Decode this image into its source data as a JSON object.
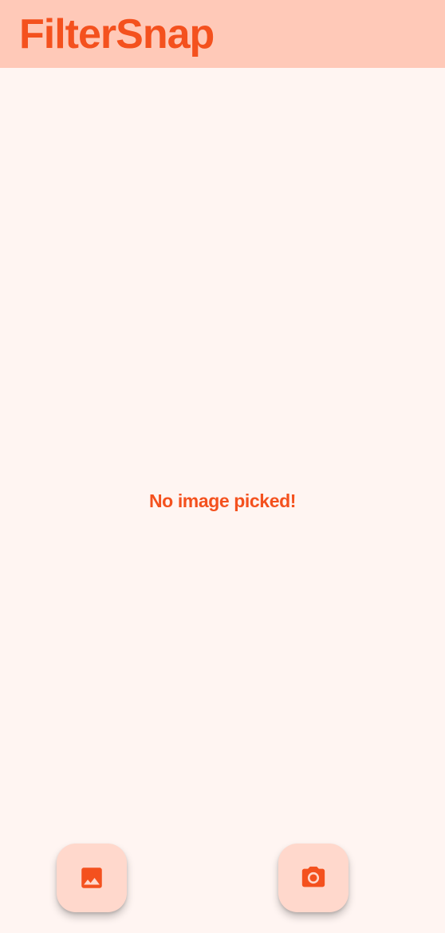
{
  "app": {
    "title": "FilterSnap"
  },
  "main": {
    "empty_message": "No image picked!"
  },
  "actions": {
    "gallery_icon": "image-icon",
    "camera_icon": "camera-icon"
  },
  "colors": {
    "accent": "#F4511E",
    "appbar_background": "#FFC9B8",
    "page_background": "#FFF5F2",
    "fab_background": "#FFD8CC"
  }
}
